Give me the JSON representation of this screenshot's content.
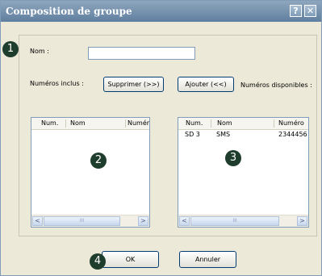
{
  "window": {
    "title": "Composition de groupe",
    "help_glyph": "?",
    "close_glyph": "✕"
  },
  "form": {
    "name_label": "Nom :",
    "name_value": "",
    "included_label": "Numéros inclus :",
    "available_label": "Numéros disponibles :",
    "remove_button": "Supprimer (>>)",
    "add_button": "Ajouter (<<)"
  },
  "included_list": {
    "columns": [
      "Num.",
      "Nom",
      "Numéro d"
    ],
    "rows": []
  },
  "available_list": {
    "columns": [
      "Num.",
      "Nom",
      "Numéro"
    ],
    "rows": [
      {
        "num": "SD 3",
        "nom": "SMS",
        "numero": "2344456"
      }
    ]
  },
  "scrollbar": {
    "left_arrow": "<",
    "right_arrow": ">",
    "thumb_grip": "III"
  },
  "footer": {
    "ok_button": "OK",
    "cancel_button": "Annuler"
  },
  "callouts": [
    "1",
    "2",
    "3",
    "4"
  ],
  "colors": {
    "dialog_bg": "#ece9d8",
    "titlebar": "#6f8aa8",
    "callout": "#1f3d2d"
  }
}
